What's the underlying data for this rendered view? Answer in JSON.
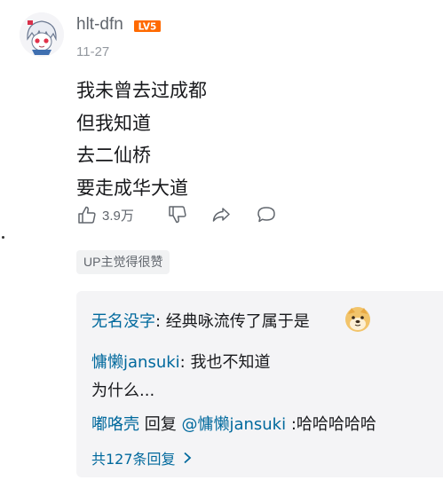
{
  "comment": {
    "username": "hlt-dfn",
    "level_badge": "LV5",
    "date": "11-27",
    "lines": [
      "我未曾去过成都",
      "但我知道",
      "去二仙桥",
      "要走成华大道"
    ],
    "like_count": "3.9万",
    "up_badge": "UP主觉得很赞"
  },
  "replies": {
    "items": [
      {
        "user": "无名没字",
        "sep": ": ",
        "text": "经典咏流传了属于是",
        "emoji": "doge-emoji"
      },
      {
        "user": "慵懒jansuki",
        "sep": ": ",
        "text": "我也不知道",
        "text2": "为什么..."
      },
      {
        "user": "嘟咯壳",
        "reply_word": " 回复 ",
        "mention": "@慵懒jansuki",
        "sep": " :",
        "text": "哈哈哈哈哈"
      }
    ],
    "more_label": "共127条回复"
  },
  "colors": {
    "link": "#00699d",
    "text": "#18191c",
    "muted": "#9499a0",
    "level": "#ff6a00"
  },
  "icons": [
    "like-icon",
    "dislike-icon",
    "share-icon",
    "reply-icon",
    "chevron-right-icon"
  ]
}
